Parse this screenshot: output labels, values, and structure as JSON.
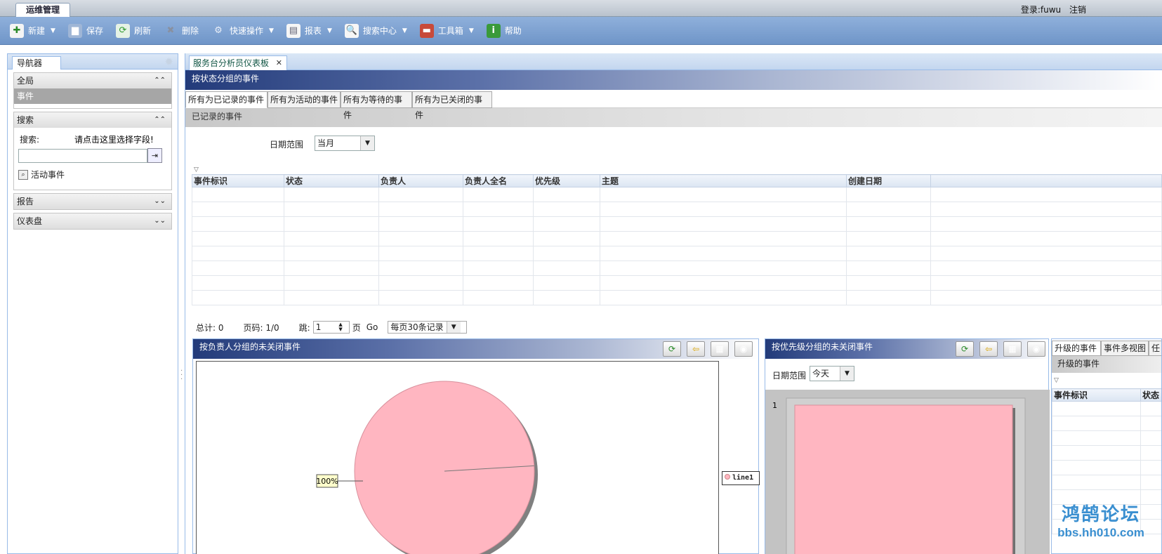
{
  "app": {
    "tab": "运维管理",
    "login_label": "登录:fuwu",
    "logout": "注销"
  },
  "toolbar": {
    "items": [
      {
        "label": "新建",
        "icon": "new-icon",
        "dropdown": true
      },
      {
        "label": "保存",
        "icon": "save-icon",
        "dropdown": false
      },
      {
        "label": "刷新",
        "icon": "refresh-icon",
        "dropdown": false
      },
      {
        "label": "删除",
        "icon": "delete-icon",
        "dropdown": false
      },
      {
        "label": "快速操作",
        "icon": "quick-action-icon",
        "dropdown": true
      },
      {
        "label": "报表",
        "icon": "report-icon",
        "dropdown": true
      },
      {
        "label": "搜索中心",
        "icon": "search-center-icon",
        "dropdown": true
      },
      {
        "label": "工具箱",
        "icon": "toolbox-icon",
        "dropdown": true
      },
      {
        "label": "帮助",
        "icon": "help-icon",
        "dropdown": false
      }
    ]
  },
  "nav": {
    "title": "导航器",
    "sections": {
      "global": {
        "title": "全局",
        "selected_item": "事件"
      },
      "search": {
        "title": "搜索",
        "label": "搜索:",
        "hint": "请点击这里选择字段!",
        "input_value": "",
        "active_events": "活动事件"
      },
      "reports": {
        "title": "报告"
      },
      "dashboard": {
        "title": "仪表盘"
      }
    }
  },
  "main": {
    "tab_label": "服务台分析员仪表板",
    "panel_title": "按状态分组的事件",
    "subtabs": [
      "所有为已记录的事件",
      "所有为活动的事件",
      "所有为等待的事件",
      "所有为已关闭的事件"
    ],
    "sub_label": "已记录的事件",
    "date_range_label": "日期范围",
    "date_range_value": "当月",
    "columns": [
      "事件标识",
      "状态",
      "负责人",
      "负责人全名",
      "优先级",
      "主题",
      "创建日期"
    ],
    "pager": {
      "total": "总计: 0",
      "page": "页码: 1/0",
      "jump_label": "跳:",
      "jump_value": "1",
      "page_suffix": "页",
      "go": "Go",
      "per_page": "每页30条记录"
    }
  },
  "panel_owner": {
    "title": "按负责人分组的未关闭事件",
    "legend": "line1"
  },
  "panel_priority": {
    "title": "按优先级分组的未关闭事件",
    "date_range_label": "日期范围",
    "date_range_value": "今天",
    "y_tick": "1"
  },
  "panel_escalated": {
    "tabs": [
      "升级的事件",
      "事件多视图",
      "任"
    ],
    "sub_label": "升级的事件",
    "columns": [
      "事件标识",
      "状态"
    ]
  },
  "chart_data": [
    {
      "type": "pie",
      "categories": [
        "line1"
      ],
      "values": [
        100
      ],
      "labels": [
        "100%"
      ],
      "colors": [
        "#ffb6c1"
      ]
    },
    {
      "type": "bar",
      "categories": [
        ""
      ],
      "values": [
        1
      ],
      "colors": [
        "#ffb6c1"
      ]
    }
  ],
  "watermark": {
    "line1": "鸿鹄论坛",
    "line2": "bbs.hh010.com"
  }
}
